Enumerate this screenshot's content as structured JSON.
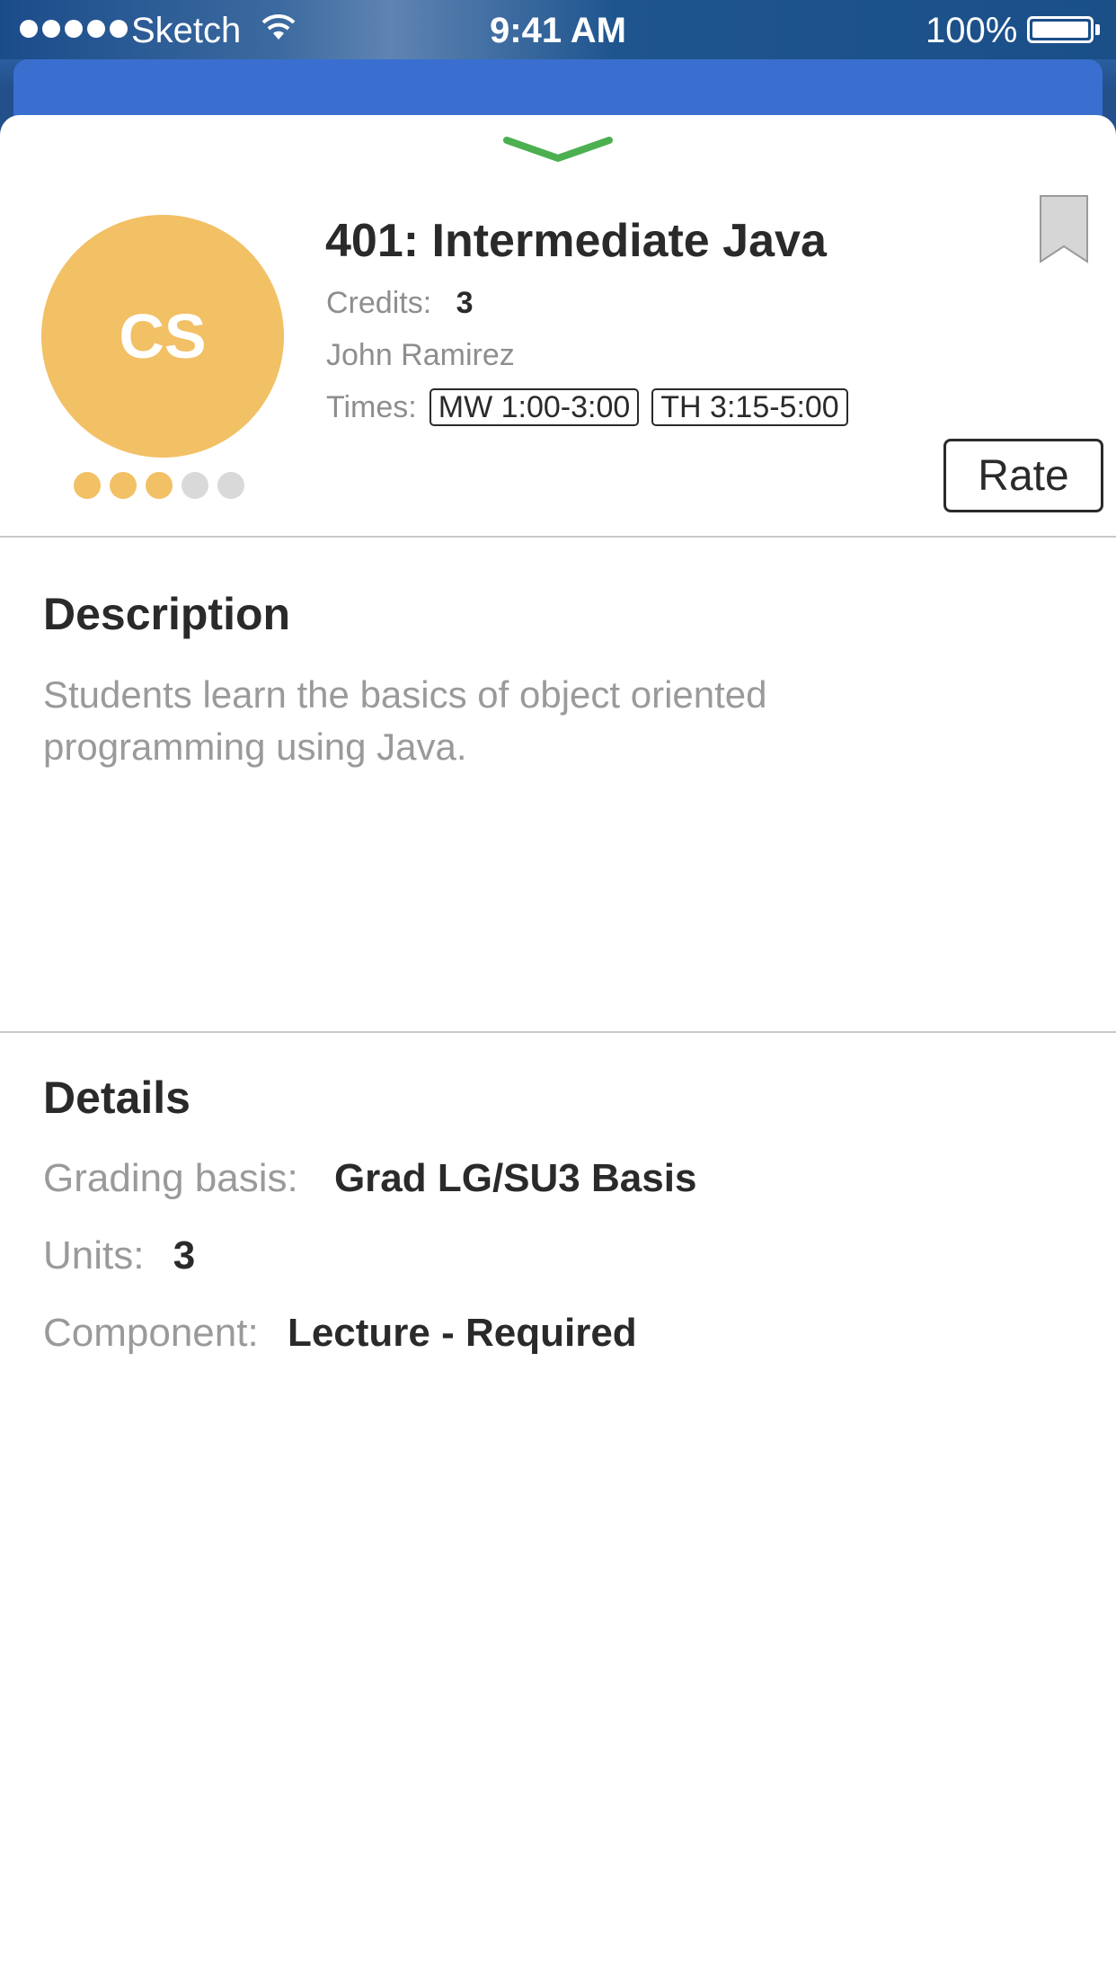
{
  "status_bar": {
    "carrier": "Sketch",
    "time": "9:41 AM",
    "battery": "100%"
  },
  "course": {
    "avatar_initials": "CS",
    "title": "401: Intermediate Java",
    "credits_label": "Credits:",
    "credits_value": "3",
    "instructor": "John Ramirez",
    "times_label": "Times:",
    "times": [
      "MW 1:00-3:00",
      "TH 3:15-5:00"
    ],
    "rating": 3,
    "rating_max": 5,
    "rate_button": "Rate"
  },
  "description": {
    "heading": "Description",
    "text": "Students learn the basics of object oriented programming using Java."
  },
  "details": {
    "heading": "Details",
    "rows": [
      {
        "label": "Grading basis:",
        "value": "Grad LG/SU3 Basis"
      },
      {
        "label": "Units:",
        "value": "3"
      },
      {
        "label": "Component:",
        "value": "Lecture - Required"
      }
    ]
  },
  "colors": {
    "avatar": "#f2c065",
    "rating_filled": "#f2c065",
    "rating_empty": "#d9d9d9",
    "grabber": "#4caf50",
    "underlying_card": "#3a6fd0"
  },
  "icons": [
    "signal-icon",
    "wifi-icon",
    "battery-icon",
    "chevron-down-icon",
    "bookmark-icon"
  ]
}
